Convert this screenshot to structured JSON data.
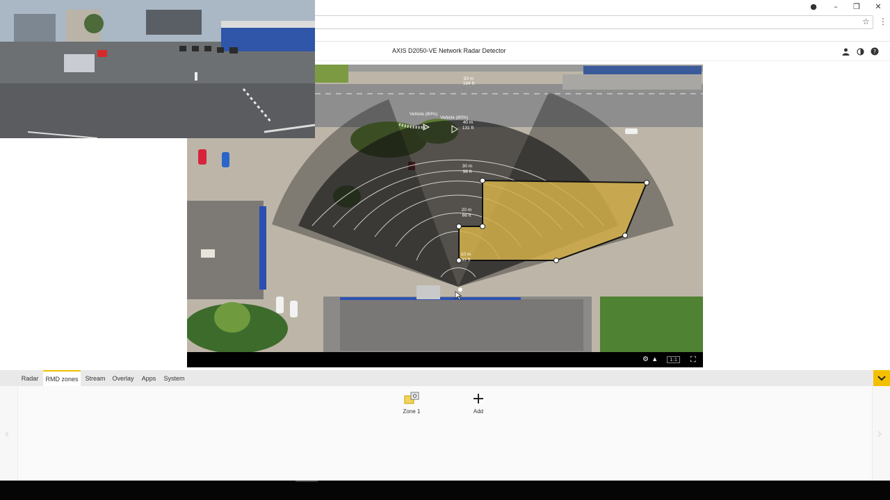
{
  "browser": {
    "window_controls": {
      "minimize": "–",
      "restore": "❐",
      "close": "✕"
    }
  },
  "app": {
    "title": "AXIS D2050-VE Network Radar Detector",
    "header_icons": [
      "user-icon",
      "contrast-icon",
      "help-icon"
    ]
  },
  "radar": {
    "range_labels": [
      {
        "m": "50 m",
        "ft": "164 ft"
      },
      {
        "m": "40 m",
        "ft": "131 ft"
      },
      {
        "m": "30 m",
        "ft": "98 ft"
      },
      {
        "m": "20 m",
        "ft": "66 ft"
      },
      {
        "m": "10 m",
        "ft": "33 ft"
      }
    ],
    "detections": [
      {
        "label": "Vehicle (80%)"
      },
      {
        "label": "Vehicle (80%)"
      }
    ],
    "zone_color": "#d4b04a",
    "controls": {
      "settings_icon": "gear-icon",
      "aspect_label": "1:1",
      "fullscreen_icon": "fullscreen-icon"
    }
  },
  "tabs": [
    {
      "label": "Radar",
      "active": false
    },
    {
      "label": "RMD zones",
      "active": true
    },
    {
      "label": "Stream",
      "active": false
    },
    {
      "label": "Overlay",
      "active": false
    },
    {
      "label": "Apps",
      "active": false
    },
    {
      "label": "System",
      "active": false
    }
  ],
  "accent_color": "#f3c000",
  "zones_panel": {
    "items": [
      {
        "label": "Zone 1",
        "icon": "zone-icon"
      },
      {
        "label": "Add",
        "icon": "plus-icon"
      }
    ]
  }
}
